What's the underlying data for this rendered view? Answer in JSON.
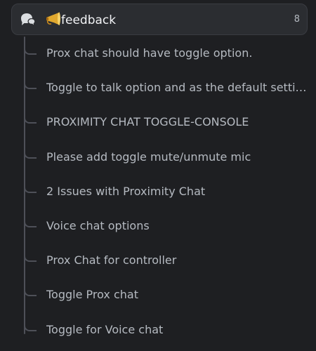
{
  "channel": {
    "emoji": "📯",
    "name": "feedback",
    "count": "8",
    "icon": "forum-icon"
  },
  "threads": [
    {
      "title": "Prox chat should have toggle option."
    },
    {
      "title": "Toggle to talk option and as the default setting"
    },
    {
      "title": "PROXIMITY CHAT TOGGLE-CONSOLE"
    },
    {
      "title": "Please add toggle mute/unmute mic"
    },
    {
      "title": "2 Issues with Proximity Chat"
    },
    {
      "title": "Voice chat options"
    },
    {
      "title": "Prox Chat for controller"
    },
    {
      "title": "Toggle Prox chat"
    },
    {
      "title": "Toggle for Voice chat"
    }
  ],
  "colors": {
    "background": "#1e1f22",
    "header_background": "#2b2d31",
    "text_primary": "#f2f3f5",
    "text_muted": "#b5bac1",
    "connector": "#4e5058"
  }
}
